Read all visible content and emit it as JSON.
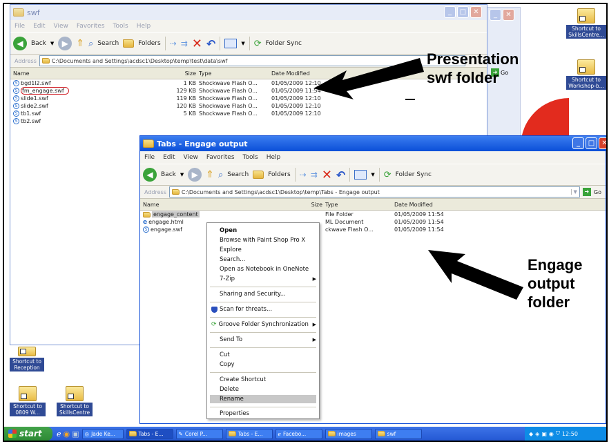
{
  "win1": {
    "title": "swf",
    "menu": [
      "File",
      "Edit",
      "View",
      "Favorites",
      "Tools",
      "Help"
    ],
    "toolbar": {
      "back": "Back",
      "search": "Search",
      "folders": "Folders",
      "sync": "Folder Sync"
    },
    "address_label": "Address",
    "address": "C:\\Documents and Settings\\acdsc1\\Desktop\\temp\\test\\data\\swf",
    "columns": [
      "Name",
      "Size",
      "Type",
      "Date Modified"
    ],
    "files": [
      {
        "name": "bgd1l2.swf",
        "size": "1 KB",
        "type": "Shockwave Flash O...",
        "date": "01/05/2009 12:10"
      },
      {
        "name": "fm_engage.swf",
        "size": "129 KB",
        "type": "Shockwave Flash O...",
        "date": "01/05/2009 11:54"
      },
      {
        "name": "slide1.swf",
        "size": "119 KB",
        "type": "Shockwave Flash O...",
        "date": "01/05/2009 12:10"
      },
      {
        "name": "slide2.swf",
        "size": "120 KB",
        "type": "Shockwave Flash O...",
        "date": "01/05/2009 12:10"
      },
      {
        "name": "tb1.swf",
        "size": "5 KB",
        "type": "Shockwave Flash O...",
        "date": "01/05/2009 12:10"
      },
      {
        "name": "tb2.swf",
        "size": "",
        "type": "",
        "date": ""
      }
    ]
  },
  "win2": {
    "title": "Tabs - Engage output",
    "menu": [
      "File",
      "Edit",
      "View",
      "Favorites",
      "Tools",
      "Help"
    ],
    "toolbar": {
      "back": "Back",
      "search": "Search",
      "folders": "Folders",
      "sync": "Folder Sync"
    },
    "address_label": "Address",
    "address": "C:\\Documents and Settings\\acdsc1\\Desktop\\temp\\Tabs - Engage output",
    "go": "Go",
    "columns": [
      "Name",
      "Size",
      "Type",
      "Date Modified"
    ],
    "files": [
      {
        "name": "engage_content",
        "type": "File Folder",
        "date": "01/05/2009 11:54"
      },
      {
        "name": "engage.html",
        "type": "ML Document",
        "date": "01/05/2009 11:54"
      },
      {
        "name": "engage.swf",
        "type": "ckwave Flash O...",
        "date": "01/05/2009 11:54"
      }
    ]
  },
  "context_menu": {
    "open": "Open",
    "browse_psp": "Browse with Paint Shop Pro X",
    "explore": "Explore",
    "search": "Search...",
    "onenote": "Open as Notebook in OneNote",
    "zip": "7-Zip",
    "sharing": "Sharing and Security...",
    "scan": "Scan for threats...",
    "groove": "Groove Folder Synchronization",
    "send_to": "Send To",
    "cut": "Cut",
    "copy": "Copy",
    "create_shortcut": "Create Shortcut",
    "delete": "Delete",
    "rename": "Rename",
    "properties": "Properties"
  },
  "bg_window": {
    "go": "Go"
  },
  "annotations": {
    "presentation": "Presentation swf folder",
    "engage": "Engage output folder"
  },
  "desktop": {
    "skills1": "Shortcut to SkillsCentre...",
    "workshop": "Shortcut to Workshop-b...",
    "reception": "Shortcut to Reception",
    "w0809": "Shortcut to 0809 W...",
    "skills2": "Shortcut to SkillsCentre"
  },
  "taskbar": {
    "start": "start",
    "items": [
      "Jade Ke...",
      "Tabs - E...",
      "Corel P...",
      "Tabs - E...",
      "Facebo...",
      "images",
      "swf"
    ],
    "clock": "12:50"
  },
  "colors": {
    "xp_blue": "#2458d3",
    "close_red": "#d6402b",
    "title_light": "#e7ecf7"
  }
}
